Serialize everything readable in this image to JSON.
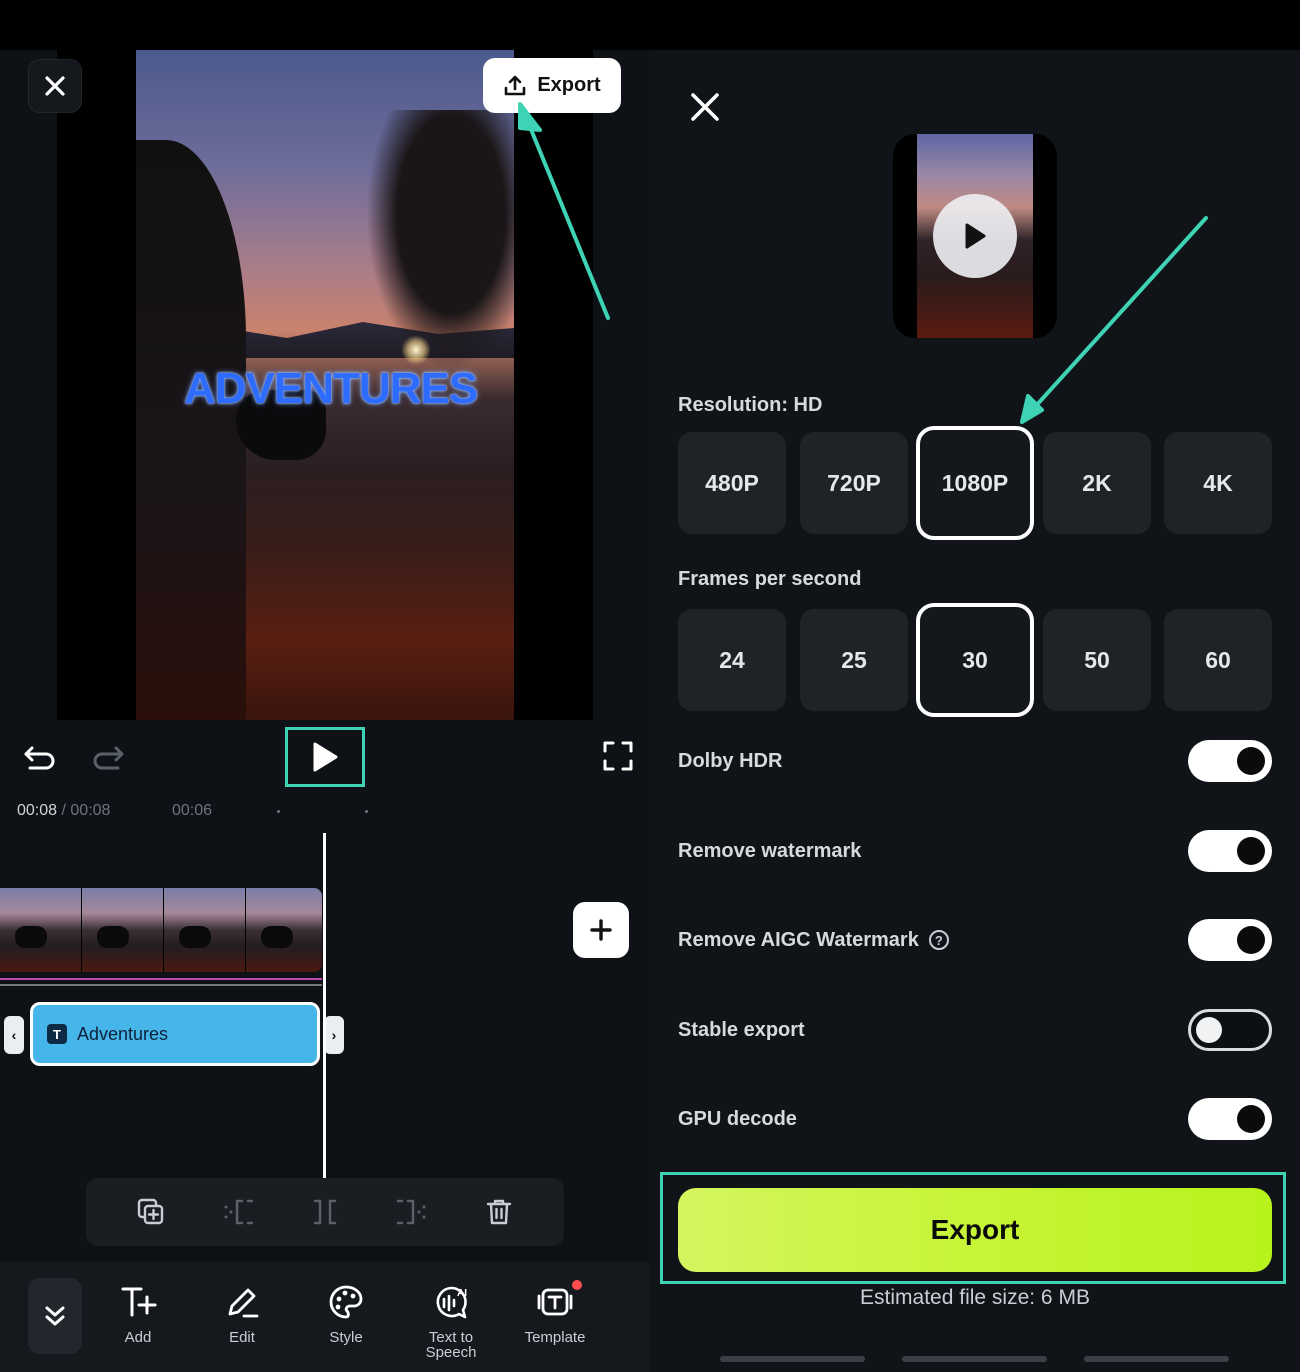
{
  "editor": {
    "export_label": "Export",
    "video_text": "ADVENTURES",
    "time_current": "00:08",
    "time_separator": " / ",
    "time_total": "00:08",
    "tick_label": "00:06",
    "text_clip_label": "Adventures",
    "text_clip_badge": "T",
    "nav": [
      {
        "label": "Add",
        "icon": "text-add-icon"
      },
      {
        "label": "Edit",
        "icon": "pen-icon"
      },
      {
        "label": "Style",
        "icon": "palette-icon"
      },
      {
        "label": "Text to Speech",
        "icon": "ai-speech-icon"
      },
      {
        "label": "Template",
        "icon": "template-icon"
      }
    ]
  },
  "export_panel": {
    "resolution_label": "Resolution: HD",
    "resolutions": [
      "480P",
      "720P",
      "1080P",
      "2K",
      "4K"
    ],
    "selected_resolution": "1080P",
    "fps_label": "Frames per second",
    "fps_options": [
      "24",
      "25",
      "30",
      "50",
      "60"
    ],
    "selected_fps": "30",
    "toggles": [
      {
        "label": "Dolby HDR",
        "on": true
      },
      {
        "label": "Remove watermark",
        "on": true
      },
      {
        "label": "Remove AIGC Watermark",
        "on": true,
        "help": "?"
      },
      {
        "label": "Stable export",
        "on": false
      },
      {
        "label": "GPU decode",
        "on": true
      }
    ],
    "export_button": "Export",
    "estimate": "Estimated file size: 6 MB"
  },
  "colors": {
    "highlight": "#3fd3b5",
    "export_green": "#c6f536",
    "clip_blue": "#46b5ea"
  }
}
